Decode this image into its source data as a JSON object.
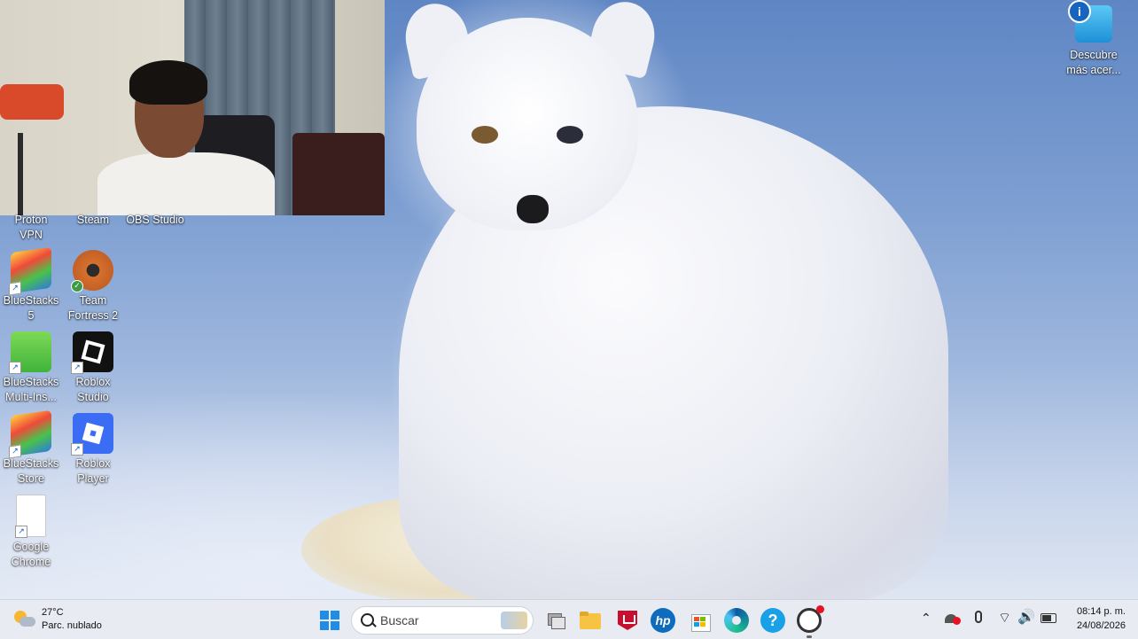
{
  "desktop_icons": [
    {
      "id": "proton-vpn",
      "label": "Proton\nVPN"
    },
    {
      "id": "steam",
      "label": "Steam"
    },
    {
      "id": "obs-studio",
      "label": "OBS Studio"
    },
    {
      "id": "bluestacks-5",
      "label": "BlueStacks\n5"
    },
    {
      "id": "team-fortress-2",
      "label": "Team\nFortress 2"
    },
    {
      "id": "bluestacks-multi",
      "label": "BlueStacks\nMulti-Ins..."
    },
    {
      "id": "roblox-studio",
      "label": "Roblox\nStudio"
    },
    {
      "id": "bluestacks-store",
      "label": "BlueStacks\nStore"
    },
    {
      "id": "roblox-player",
      "label": "Roblox\nPlayer"
    },
    {
      "id": "google-chrome",
      "label": "Google\nChrome"
    }
  ],
  "spotlight": {
    "label_line1": "Descubre",
    "label_line2": "más acer..."
  },
  "taskbar": {
    "weather_temp": "27°C",
    "weather_desc": "Parc. nublado",
    "search_placeholder": "Buscar",
    "pinned_icons": [
      "windows-start-icon",
      "search-icon",
      "task-view-icon",
      "file-explorer-icon",
      "mcafee-icon",
      "hp-icon",
      "microsoft-store-icon",
      "edge-icon",
      "help-icon",
      "obs-icon"
    ],
    "time": "08:14 p. m.",
    "date": "24/08/2026"
  },
  "colors": {
    "taskbar_bg": "#e8ebf2",
    "desktop_sky": "#7e9fd2"
  }
}
